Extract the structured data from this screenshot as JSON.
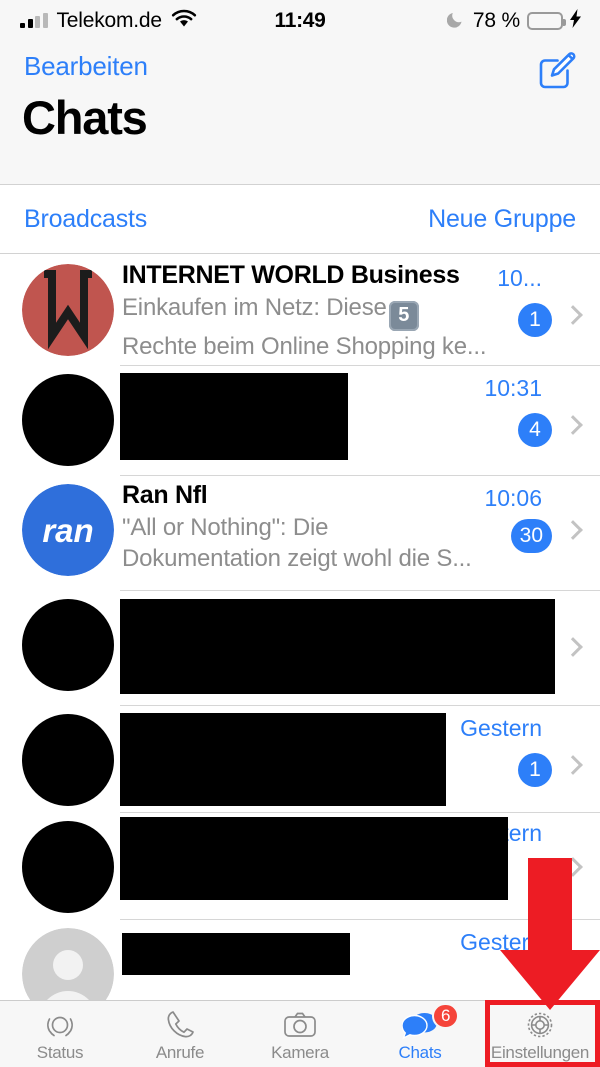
{
  "statusbar": {
    "carrier": "Telekom.de",
    "time": "11:49",
    "battery_percent": "78 %",
    "icons": {
      "signal": "signal-bars-icon",
      "wifi": "wifi-icon",
      "dnd": "moon-icon",
      "battery": "battery-icon",
      "charging": "lightning-bolt-icon"
    }
  },
  "navbar": {
    "edit_label": "Bearbeiten",
    "title": "Chats",
    "compose_icon": "compose-pencil-icon"
  },
  "subbar": {
    "broadcasts_label": "Broadcasts",
    "new_group_label": "Neue Gruppe"
  },
  "chats": [
    {
      "name": "INTERNET WORLD Business",
      "message_line1": "Einkaufen im Netz: Diese",
      "keycap": "5",
      "message_line2": "Rechte beim Online Shopping ke...",
      "time": "10...",
      "badge": "1",
      "avatar_type": "logo-internet-world",
      "redacted": false
    },
    {
      "name": "",
      "message_line1": "",
      "message_line2": "",
      "time": "10:31",
      "badge": "4",
      "avatar_type": "redacted",
      "redacted": true
    },
    {
      "name": "Ran Nfl",
      "message_line1": "\"All or Nothing\": Die",
      "message_line2": "Dokumentation zeigt wohl die S...",
      "time": "10:06",
      "badge": "30",
      "avatar_type": "logo-ran",
      "redacted": false
    },
    {
      "name": "",
      "message_line1": "",
      "message_line2": "",
      "time": "",
      "badge": "",
      "avatar_type": "redacted",
      "redacted": true
    },
    {
      "name": "",
      "message_line1": "",
      "message_line2": "",
      "time": "Gestern",
      "badge": "1",
      "avatar_type": "redacted",
      "redacted": true
    },
    {
      "name": "",
      "message_line1": "",
      "message_line2": "",
      "time": "Gestern",
      "badge": "",
      "avatar_type": "redacted",
      "redacted": true
    },
    {
      "name": "",
      "message_line1": "",
      "message_line2": "",
      "time": "Gestern",
      "badge": "",
      "avatar_type": "default-person",
      "redacted": true
    }
  ],
  "avatars": {
    "ran_text": "ran"
  },
  "tabbar": {
    "items": [
      {
        "label": "Status",
        "icon": "status-rings-icon",
        "active": false,
        "badge": ""
      },
      {
        "label": "Anrufe",
        "icon": "phone-icon",
        "active": false,
        "badge": ""
      },
      {
        "label": "Kamera",
        "icon": "camera-icon",
        "active": false,
        "badge": ""
      },
      {
        "label": "Chats",
        "icon": "chat-bubbles-icon",
        "active": true,
        "badge": "6"
      },
      {
        "label": "Einstellungen",
        "icon": "gear-icon",
        "active": false,
        "badge": ""
      }
    ]
  },
  "annotations": {
    "arrow": "red-down-arrow",
    "highlight": "red-highlight-box",
    "accent_color": "#ed1c24"
  },
  "colors": {
    "ios_blue": "#2d7ff9",
    "badge_red": "#f5443a",
    "ran_blue": "#2f6fdb",
    "iw_red": "#c0554f"
  }
}
